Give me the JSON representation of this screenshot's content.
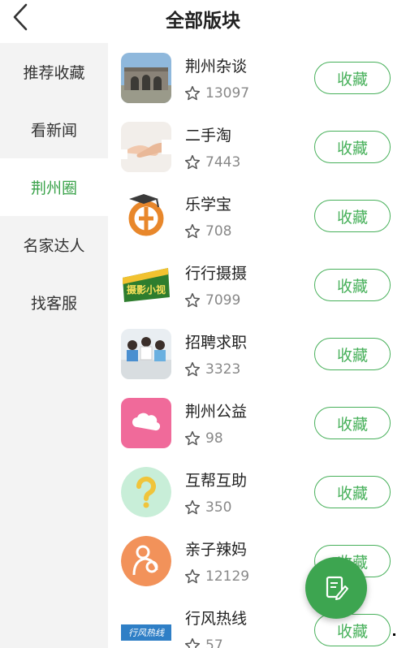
{
  "header": {
    "title": "全部版块"
  },
  "sidebar": {
    "items": [
      {
        "label": "推荐收藏",
        "active": false
      },
      {
        "label": "看新闻",
        "active": false
      },
      {
        "label": "荆州圈",
        "active": true
      },
      {
        "label": "名家达人",
        "active": false
      },
      {
        "label": "找客服",
        "active": false
      }
    ]
  },
  "boards": [
    {
      "name": "荆州杂谈",
      "count": "13097",
      "button": "收藏",
      "thumb": "city-gate"
    },
    {
      "name": "二手淘",
      "count": "7443",
      "button": "收藏",
      "thumb": "handshake"
    },
    {
      "name": "乐学宝",
      "count": "708",
      "button": "收藏",
      "thumb": "graduation-logo"
    },
    {
      "name": "行行摄摄",
      "count": "7099",
      "button": "收藏",
      "thumb": "photo-logo"
    },
    {
      "name": "招聘求职",
      "count": "3323",
      "button": "收藏",
      "thumb": "office-meeting"
    },
    {
      "name": "荆州公益",
      "count": "98",
      "button": "收藏",
      "thumb": "pink-hearts"
    },
    {
      "name": "互帮互助",
      "count": "350",
      "button": "收藏",
      "thumb": "question-mark"
    },
    {
      "name": "亲子辣妈",
      "count": "12129",
      "button": "收藏",
      "thumb": "mother-baby"
    },
    {
      "name": "行风热线",
      "count": "57",
      "button": "收藏",
      "thumb": "hotline-banner"
    }
  ],
  "thumb_text": {
    "photo_logo": "摄影小视",
    "hotline_banner": "行风热线"
  },
  "colors": {
    "accent": "#3aa24a",
    "sidebar_bg": "#f3f3f3"
  },
  "fab": {
    "icon": "edit-note-icon"
  }
}
